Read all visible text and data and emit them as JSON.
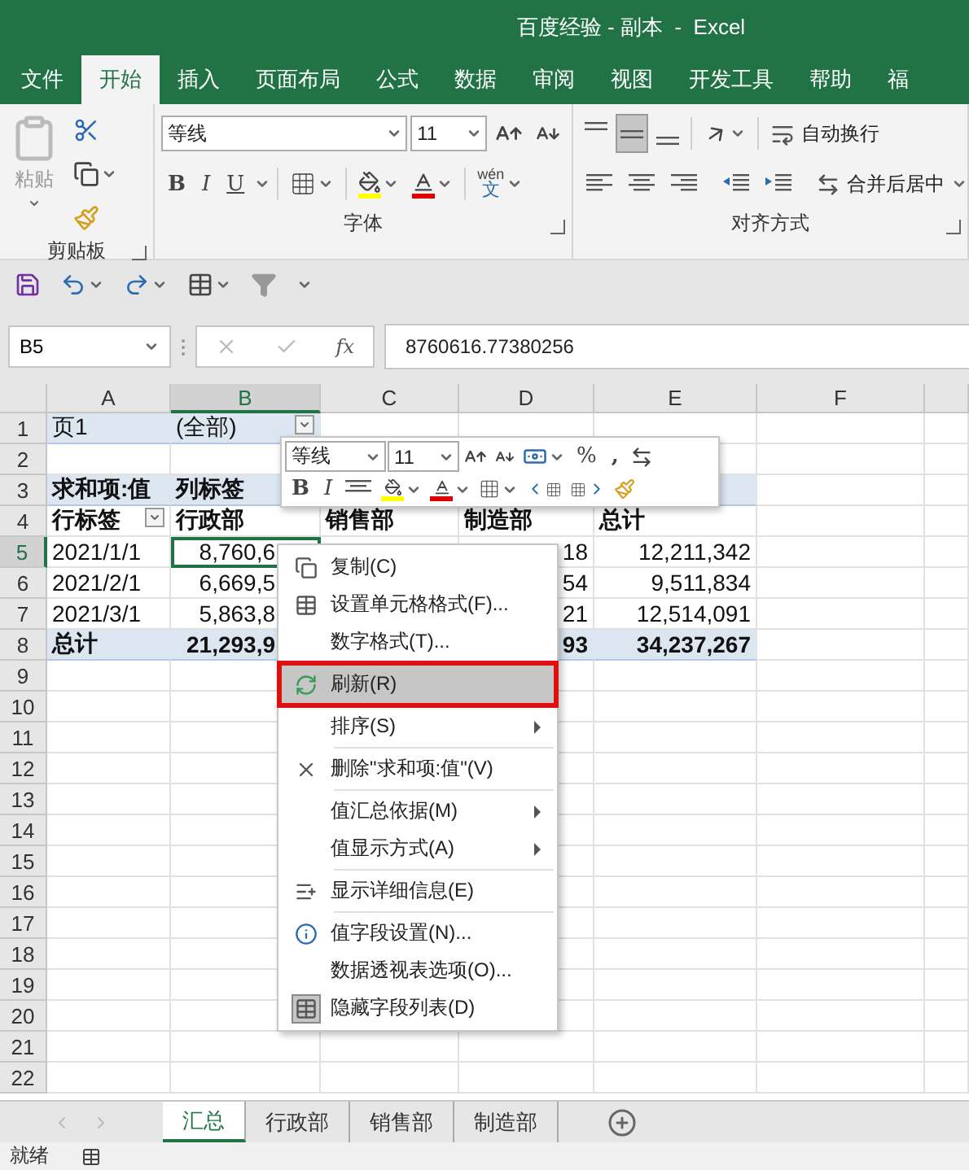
{
  "window": {
    "title": "百度经验 - 副本  -  Excel"
  },
  "tabs": [
    {
      "label": "文件",
      "selected": false
    },
    {
      "label": "开始",
      "selected": true
    },
    {
      "label": "插入",
      "selected": false
    },
    {
      "label": "页面布局",
      "selected": false
    },
    {
      "label": "公式",
      "selected": false
    },
    {
      "label": "数据",
      "selected": false
    },
    {
      "label": "审阅",
      "selected": false
    },
    {
      "label": "视图",
      "selected": false
    },
    {
      "label": "开发工具",
      "selected": false
    },
    {
      "label": "帮助",
      "selected": false
    },
    {
      "label": "福",
      "selected": false
    }
  ],
  "ribbon": {
    "clipboard": {
      "label": "剪贴板",
      "paste": "粘贴"
    },
    "font": {
      "label": "字体",
      "font_name": "等线",
      "font_size": "11",
      "bold": "B",
      "italic": "I",
      "underline": "U",
      "phonetic_ruby": "wén",
      "phonetic_base": "文"
    },
    "alignment": {
      "label": "对齐方式",
      "vertical": [
        {
          "selected": false
        },
        {
          "selected": true
        },
        {
          "selected": false
        }
      ],
      "wrap_text": "自动换行",
      "merge": "合并后居中"
    }
  },
  "formula_bar": {
    "name_box": "B5",
    "function_label": "fx",
    "value": "8760616.77380256"
  },
  "sheet": {
    "columns": [
      {
        "label": "A",
        "selected": false
      },
      {
        "label": "B",
        "selected": true
      },
      {
        "label": "C",
        "selected": false
      },
      {
        "label": "D",
        "selected": false
      },
      {
        "label": "E",
        "selected": false
      },
      {
        "label": "F",
        "selected": false
      }
    ],
    "rows": [
      {
        "number": "1",
        "kind": "filter",
        "selected": false,
        "cells": [
          "页1",
          "(全部)",
          "",
          "",
          ""
        ]
      },
      {
        "number": "2",
        "kind": "plain",
        "selected": false,
        "cells": [
          "",
          "",
          "",
          "",
          ""
        ]
      },
      {
        "number": "3",
        "kind": "header",
        "selected": false,
        "cells": [
          "求和项:值",
          "列标签",
          "",
          "",
          ""
        ]
      },
      {
        "number": "4",
        "kind": "labels",
        "selected": false,
        "cells": [
          "行标签",
          "行政部",
          "销售部",
          "制造部",
          "总计"
        ]
      },
      {
        "number": "5",
        "kind": "data",
        "selected": true,
        "cells": [
          "2021/1/1",
          "8,760,6",
          "",
          "18",
          "12,211,342"
        ]
      },
      {
        "number": "6",
        "kind": "data",
        "selected": false,
        "cells": [
          "2021/2/1",
          "6,669,5",
          "",
          "54",
          "9,511,834"
        ]
      },
      {
        "number": "7",
        "kind": "data",
        "selected": false,
        "cells": [
          "2021/3/1",
          "5,863,8",
          "",
          "21",
          "12,514,091"
        ]
      },
      {
        "number": "8",
        "kind": "total",
        "selected": false,
        "cells": [
          "总计",
          "21,293,9",
          "",
          "93",
          "34,237,267"
        ]
      },
      {
        "number": "9",
        "kind": "plain",
        "selected": false,
        "cells": []
      },
      {
        "number": "10",
        "kind": "plain",
        "selected": false,
        "cells": []
      },
      {
        "number": "11",
        "kind": "plain",
        "selected": false,
        "cells": []
      },
      {
        "number": "12",
        "kind": "plain",
        "selected": false,
        "cells": []
      },
      {
        "number": "13",
        "kind": "plain",
        "selected": false,
        "cells": []
      },
      {
        "number": "14",
        "kind": "plain",
        "selected": false,
        "cells": []
      },
      {
        "number": "15",
        "kind": "plain",
        "selected": false,
        "cells": []
      },
      {
        "number": "16",
        "kind": "plain",
        "selected": false,
        "cells": []
      },
      {
        "number": "17",
        "kind": "plain",
        "selected": false,
        "cells": []
      },
      {
        "number": "18",
        "kind": "plain",
        "selected": false,
        "cells": []
      },
      {
        "number": "19",
        "kind": "plain",
        "selected": false,
        "cells": []
      },
      {
        "number": "20",
        "kind": "plain",
        "selected": false,
        "cells": []
      },
      {
        "number": "21",
        "kind": "plain",
        "selected": false,
        "cells": []
      },
      {
        "number": "22",
        "kind": "plain",
        "selected": false,
        "cells": []
      }
    ]
  },
  "mini_toolbar": {
    "font_name": "等线",
    "font_size": "11",
    "percent": "%",
    "comma": ",",
    "bold": "B",
    "italic": "I"
  },
  "context_menu": [
    {
      "kind": "item",
      "label": "复制(C)",
      "selected": false,
      "outlined": false,
      "submenu": false,
      "checked": false
    },
    {
      "kind": "item",
      "label": "设置单元格格式(F)...",
      "selected": false,
      "outlined": false,
      "submenu": false,
      "checked": false
    },
    {
      "kind": "item",
      "label": "数字格式(T)...",
      "selected": false,
      "outlined": false,
      "submenu": false,
      "checked": false
    },
    {
      "kind": "separator"
    },
    {
      "kind": "item",
      "label": "刷新(R)",
      "selected": true,
      "outlined": true,
      "submenu": false,
      "checked": false
    },
    {
      "kind": "separator"
    },
    {
      "kind": "item",
      "label": "排序(S)",
      "selected": false,
      "outlined": false,
      "submenu": true,
      "checked": false
    },
    {
      "kind": "separator"
    },
    {
      "kind": "item",
      "label": "删除\"求和项:值\"(V)",
      "selected": false,
      "outlined": false,
      "submenu": false,
      "checked": false
    },
    {
      "kind": "separator"
    },
    {
      "kind": "item",
      "label": "值汇总依据(M)",
      "selected": false,
      "outlined": false,
      "submenu": true,
      "checked": false
    },
    {
      "kind": "item",
      "label": "值显示方式(A)",
      "selected": false,
      "outlined": false,
      "submenu": true,
      "checked": false
    },
    {
      "kind": "separator"
    },
    {
      "kind": "item",
      "label": "显示详细信息(E)",
      "selected": false,
      "outlined": false,
      "submenu": false,
      "checked": false
    },
    {
      "kind": "separator"
    },
    {
      "kind": "item",
      "label": "值字段设置(N)...",
      "selected": false,
      "outlined": false,
      "submenu": false,
      "checked": false
    },
    {
      "kind": "item",
      "label": "数据透视表选项(O)...",
      "selected": false,
      "outlined": false,
      "submenu": false,
      "checked": false
    },
    {
      "kind": "item",
      "label": "隐藏字段列表(D)",
      "selected": false,
      "outlined": false,
      "submenu": false,
      "checked": true
    }
  ],
  "sheet_tabs": [
    {
      "label": "汇总",
      "selected": true
    },
    {
      "label": "行政部",
      "selected": false
    },
    {
      "label": "销售部",
      "selected": false
    },
    {
      "label": "制造部",
      "selected": false
    }
  ],
  "status_bar": {
    "text": "就绪"
  }
}
